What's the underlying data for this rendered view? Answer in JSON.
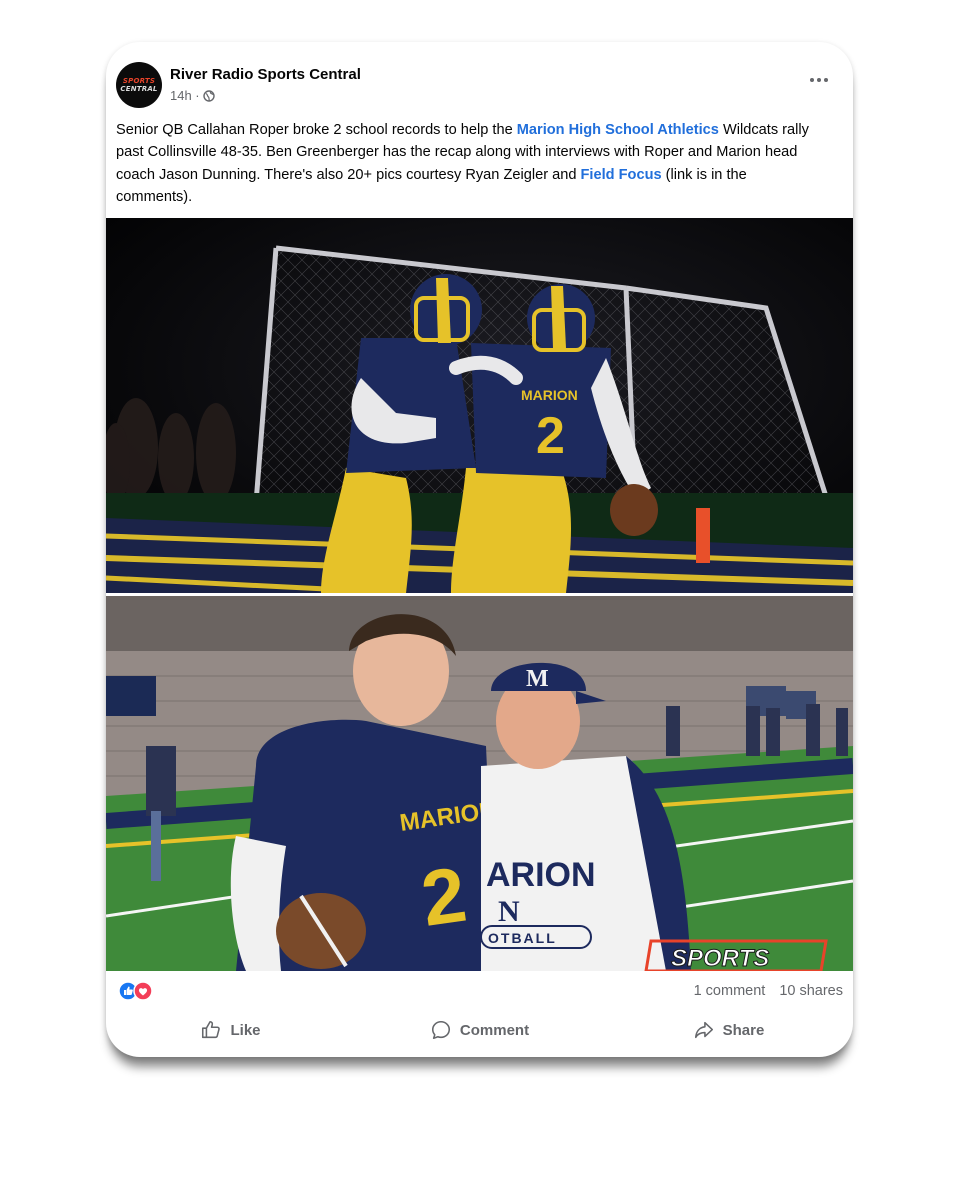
{
  "post": {
    "page_name": "River Radio Sports Central",
    "time": "14h ·",
    "avatar_line1": "SPORTS",
    "avatar_line2": "CENTRAL",
    "text_1": "Senior QB Callahan Roper broke 2 school records to help the ",
    "link_1": "Marion High School Athletics",
    "text_2": " Wildcats rally past Collinsville 48-35. Ben Greenberger has the recap along with interviews with Roper and Marion head coach Jason Dunning. There's also 20+ pics courtesy Ryan Zeigler and ",
    "link_2": "Field Focus",
    "text_3": "  (link is in the comments)."
  },
  "photo1": {
    "jersey_text": "MARION",
    "jersey_number": "2"
  },
  "photo2": {
    "jersey_text": "MARION",
    "jersey_number": "2",
    "cap_letter": "M",
    "hoodie_text": "ARION",
    "hoodie_letter": "N",
    "hoodie_sub": "OTBALL",
    "watermark": "SPORTS"
  },
  "engagement": {
    "comments": "1 comment",
    "shares": "10 shares"
  },
  "actions": {
    "like": "Like",
    "comment": "Comment",
    "share": "Share"
  },
  "colors": {
    "link": "#216fdb",
    "navy": "#1d2a5e",
    "gold": "#e6c229",
    "like_blue": "#1877f2",
    "love_red": "#f33e58"
  },
  "icons": [
    "globe-icon",
    "more-icon",
    "like-reaction-icon",
    "love-reaction-icon",
    "like-icon",
    "comment-icon",
    "share-icon"
  ]
}
